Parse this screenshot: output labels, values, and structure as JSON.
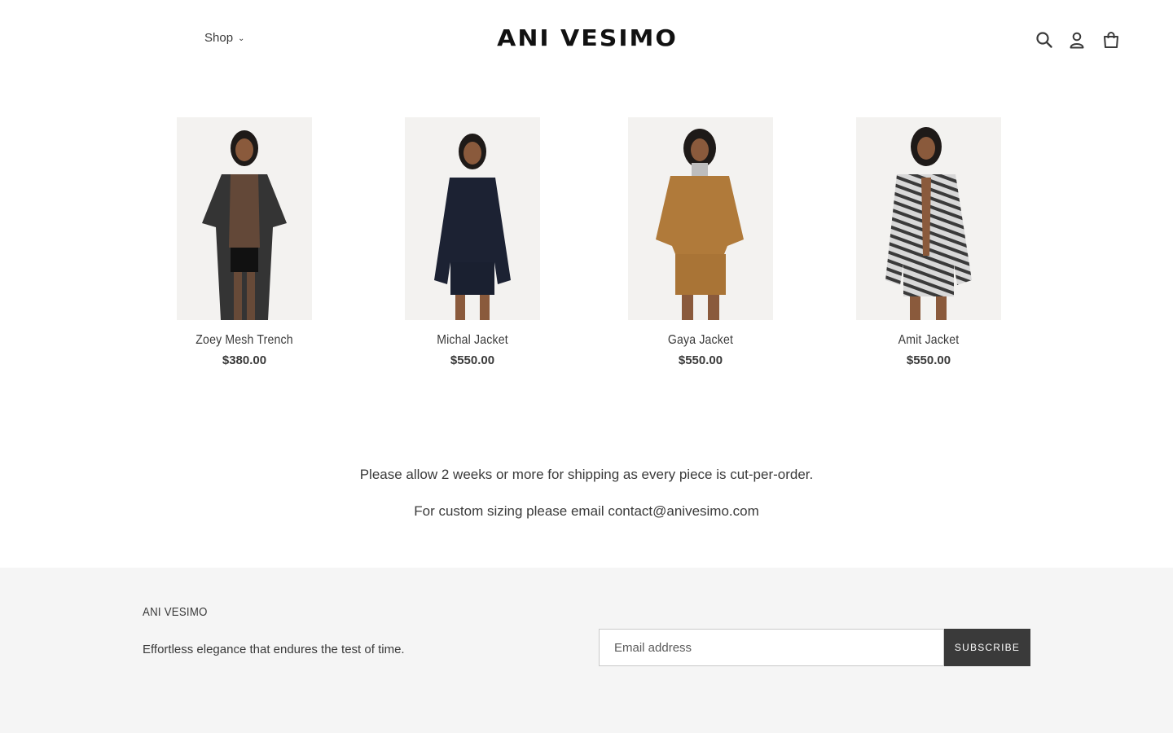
{
  "header": {
    "nav": {
      "shop_label": "Shop"
    },
    "logo": "ANI VESIMO",
    "icons": [
      "search-icon",
      "account-icon",
      "cart-icon"
    ]
  },
  "products": [
    {
      "title": "Zoey Mesh Trench",
      "price": "$380.00"
    },
    {
      "title": "Michal Jacket",
      "price": "$550.00"
    },
    {
      "title": "Gaya Jacket",
      "price": "$550.00"
    },
    {
      "title": "Amit Jacket",
      "price": "$550.00"
    }
  ],
  "notice": {
    "line1": "Please allow 2 weeks or more for shipping as every piece is cut-per-order.",
    "line2": "For custom sizing please email contact@anivesimo.com"
  },
  "footer": {
    "brand": "ANI VESIMO",
    "tagline": "Effortless elegance that endures the test of time.",
    "email_placeholder": "Email address",
    "subscribe_label": "SUBSCRIBE"
  },
  "colors": {
    "text": "#3a3a3a",
    "footer_bg": "#f5f5f5",
    "button_bg": "#3a3a3a"
  }
}
